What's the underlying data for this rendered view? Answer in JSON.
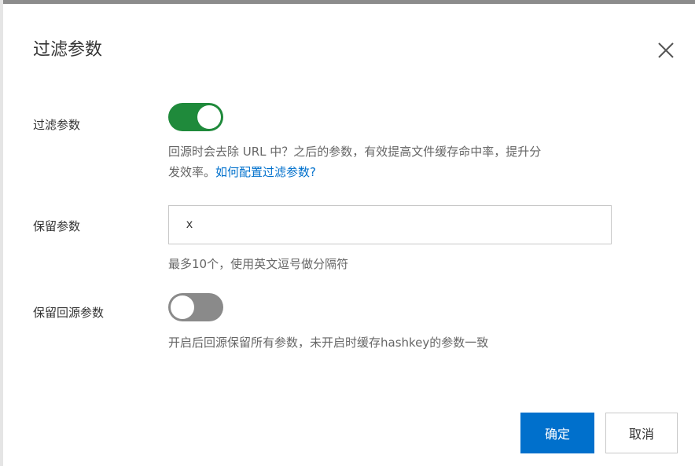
{
  "dialog": {
    "title": "过滤参数",
    "close_icon": "close-icon"
  },
  "filter_params": {
    "label": "过滤参数",
    "enabled": true,
    "description": "回源时会去除 URL 中？之后的参数，有效提高文件缓存命中率，提升分",
    "description_line2": "发效率。",
    "help_link": "如何配置过滤参数?"
  },
  "keep_params": {
    "label": "保留参数",
    "value": "x",
    "hint": "最多10个，使用英文逗号做分隔符"
  },
  "keep_origin_params": {
    "label": "保留回源参数",
    "enabled": false,
    "description": "开启后回源保留所有参数，未开启时缓存hashkey的参数一致"
  },
  "footer": {
    "confirm_label": "确定",
    "cancel_label": "取消"
  },
  "colors": {
    "accent": "#0070cc",
    "toggle_on": "#1f8a3b",
    "toggle_off": "#8a8a8a"
  }
}
